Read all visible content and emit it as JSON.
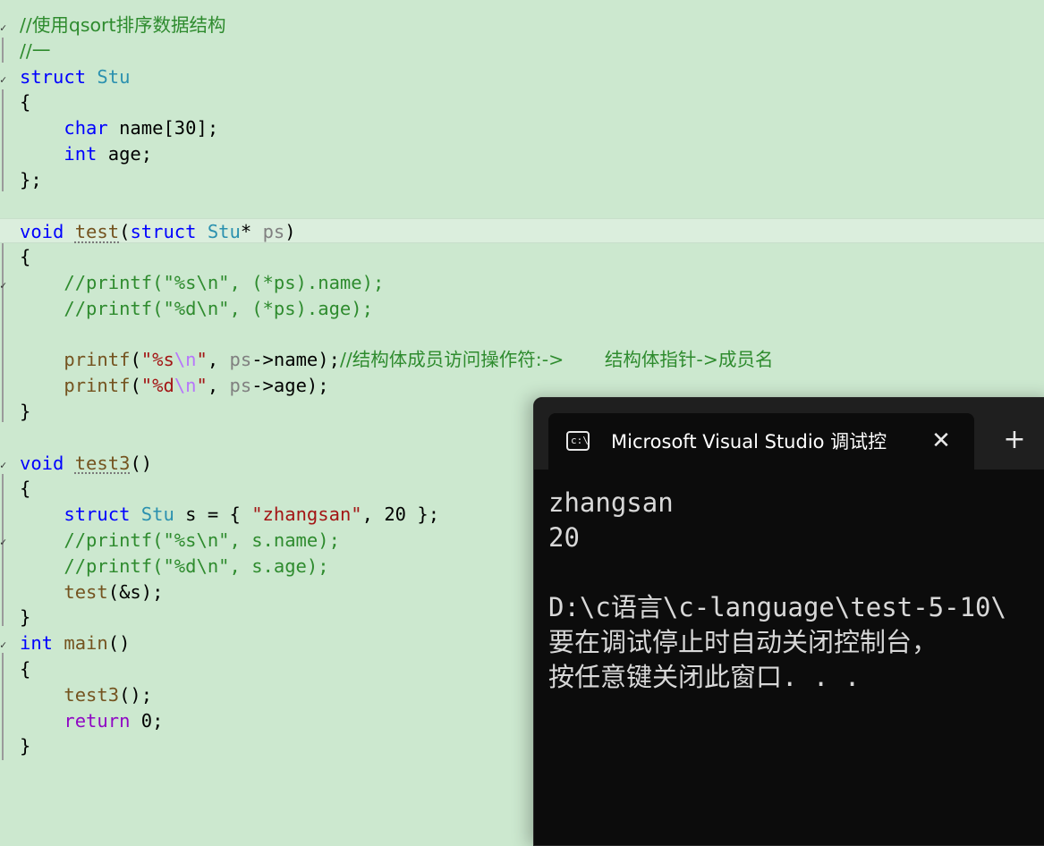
{
  "editor": {
    "lines": [
      [
        {
          "c": "cmt",
          "t": "//使用qsort排序数据结构"
        }
      ],
      [
        {
          "c": "cmt",
          "t": "//一"
        }
      ],
      [
        {
          "c": "kw",
          "t": "struct"
        },
        {
          "c": "",
          "t": " "
        },
        {
          "c": "ty",
          "t": "Stu"
        }
      ],
      [
        {
          "c": "",
          "t": "{"
        }
      ],
      [
        {
          "c": "",
          "t": "    "
        },
        {
          "c": "kw",
          "t": "char"
        },
        {
          "c": "",
          "t": " name[30];"
        }
      ],
      [
        {
          "c": "",
          "t": "    "
        },
        {
          "c": "kw",
          "t": "int"
        },
        {
          "c": "",
          "t": " age;"
        }
      ],
      [
        {
          "c": "",
          "t": "};"
        }
      ],
      [],
      [
        {
          "c": "kw",
          "t": "void"
        },
        {
          "c": "",
          "t": " "
        },
        {
          "c": "fn dots",
          "t": "test"
        },
        {
          "c": "",
          "t": "("
        },
        {
          "c": "kw",
          "t": "struct"
        },
        {
          "c": "",
          "t": " "
        },
        {
          "c": "ty",
          "t": "Stu"
        },
        {
          "c": "",
          "t": "* "
        },
        {
          "c": "par",
          "t": "ps"
        },
        {
          "c": "",
          "t": ")"
        }
      ],
      [
        {
          "c": "",
          "t": "{"
        }
      ],
      [
        {
          "c": "",
          "t": "    "
        },
        {
          "c": "cmt",
          "t": "//printf(\"%s\\n\", (*ps).name);"
        }
      ],
      [
        {
          "c": "",
          "t": "    "
        },
        {
          "c": "cmt",
          "t": "//printf(\"%d\\n\", (*ps).age);"
        }
      ],
      [],
      [
        {
          "c": "",
          "t": "    "
        },
        {
          "c": "fn",
          "t": "printf"
        },
        {
          "c": "",
          "t": "("
        },
        {
          "c": "str",
          "t": "\"%s"
        },
        {
          "c": "esc",
          "t": "\\n"
        },
        {
          "c": "str",
          "t": "\""
        },
        {
          "c": "",
          "t": ", "
        },
        {
          "c": "par",
          "t": "ps"
        },
        {
          "c": "",
          "t": "->name);"
        },
        {
          "c": "cmt",
          "t": "//结构体成员访问操作符:->       结构体指针->成员名"
        }
      ],
      [
        {
          "c": "",
          "t": "    "
        },
        {
          "c": "fn",
          "t": "printf"
        },
        {
          "c": "",
          "t": "("
        },
        {
          "c": "str",
          "t": "\"%d"
        },
        {
          "c": "esc",
          "t": "\\n"
        },
        {
          "c": "str",
          "t": "\""
        },
        {
          "c": "",
          "t": ", "
        },
        {
          "c": "par",
          "t": "ps"
        },
        {
          "c": "",
          "t": "->age);"
        }
      ],
      [
        {
          "c": "",
          "t": "}"
        }
      ],
      [],
      [
        {
          "c": "kw",
          "t": "void"
        },
        {
          "c": "",
          "t": " "
        },
        {
          "c": "fn dots",
          "t": "test3"
        },
        {
          "c": "",
          "t": "()"
        }
      ],
      [
        {
          "c": "",
          "t": "{"
        }
      ],
      [
        {
          "c": "",
          "t": "    "
        },
        {
          "c": "kw",
          "t": "struct"
        },
        {
          "c": "",
          "t": " "
        },
        {
          "c": "ty",
          "t": "Stu"
        },
        {
          "c": "",
          "t": " s = { "
        },
        {
          "c": "str",
          "t": "\"zhangsan\""
        },
        {
          "c": "",
          "t": ", 20 };"
        }
      ],
      [
        {
          "c": "",
          "t": "    "
        },
        {
          "c": "cmt",
          "t": "//printf(\"%s\\n\", s.name);"
        }
      ],
      [
        {
          "c": "",
          "t": "    "
        },
        {
          "c": "cmt",
          "t": "//printf(\"%d\\n\", s.age);"
        }
      ],
      [
        {
          "c": "",
          "t": "    "
        },
        {
          "c": "fn",
          "t": "test"
        },
        {
          "c": "",
          "t": "(&s);"
        }
      ],
      [
        {
          "c": "",
          "t": "}"
        }
      ],
      [
        {
          "c": "kw",
          "t": "int"
        },
        {
          "c": "",
          "t": " "
        },
        {
          "c": "fn",
          "t": "main"
        },
        {
          "c": "",
          "t": "()"
        }
      ],
      [
        {
          "c": "",
          "t": "{"
        }
      ],
      [
        {
          "c": "",
          "t": "    "
        },
        {
          "c": "fn",
          "t": "test3"
        },
        {
          "c": "",
          "t": "();"
        }
      ],
      [
        {
          "c": "",
          "t": "    "
        },
        {
          "c": "ret",
          "t": "return"
        },
        {
          "c": "",
          "t": " 0;"
        }
      ],
      [
        {
          "c": "",
          "t": "}"
        }
      ]
    ]
  },
  "terminal": {
    "tab_title": "Microsoft Visual Studio 调试控",
    "tab_icon_glyph": "c:\\",
    "close_glyph": "✕",
    "new_tab_glyph": "+",
    "output": [
      "zhangsan",
      "20",
      "",
      "D:\\c语言\\c-language\\test-5-10\\",
      "要在调试停止时自动关闭控制台，",
      "按任意键关闭此窗口. . ."
    ]
  },
  "colors": {
    "editor_bg": "#cce8cf",
    "comment": "#2e8b2e",
    "keyword": "#0000ff",
    "type": "#2b91af",
    "function": "#74531f",
    "string": "#a31515",
    "terminal_bg": "#0c0c0c"
  }
}
